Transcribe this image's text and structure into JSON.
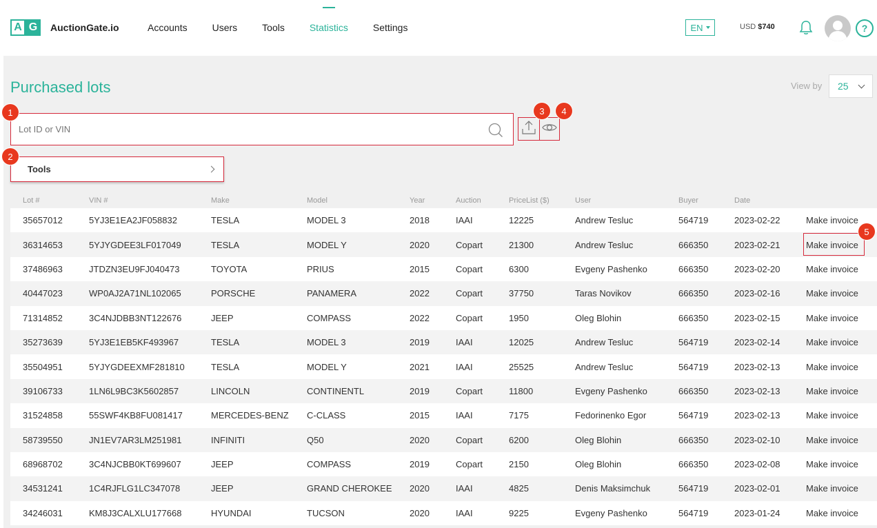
{
  "brand": {
    "logo_letter_a": "A",
    "logo_letter_g": "G",
    "name": "AuctionGate.io",
    "accent": "#2bb39a"
  },
  "nav": [
    {
      "label": "Accounts",
      "active": false
    },
    {
      "label": "Users",
      "active": false
    },
    {
      "label": "Tools",
      "active": false
    },
    {
      "label": "Statistics",
      "active": true
    },
    {
      "label": "Settings",
      "active": false
    }
  ],
  "header": {
    "language": "EN",
    "balance_currency": "USD",
    "balance_amount": "$740",
    "help": "?"
  },
  "page": {
    "title": "Purchased lots",
    "view_by_label": "View by",
    "view_by_value": "25",
    "search_placeholder": "Lot ID or VIN",
    "tools_label": "Tools"
  },
  "markers": [
    "1",
    "2",
    "3",
    "4",
    "5"
  ],
  "table": {
    "columns": [
      "Lot #",
      "VIN #",
      "Make",
      "Model",
      "Year",
      "Auction",
      "PriceList ($)",
      "User",
      "Buyer",
      "Date",
      ""
    ],
    "action_label": "Make invoice",
    "rows": [
      [
        "35657012",
        "5YJ3E1EA2JF058832",
        "TESLA",
        "MODEL 3",
        "2018",
        "IAAI",
        "12225",
        "Andrew Tesluc",
        "564719",
        "2023-02-22"
      ],
      [
        "36314653",
        "5YJYGDEE3LF017049",
        "TESLA",
        "MODEL Y",
        "2020",
        "Copart",
        "21300",
        "Andrew Tesluc",
        "666350",
        "2023-02-21"
      ],
      [
        "37486963",
        "JTDZN3EU9FJ040473",
        "TOYOTA",
        "PRIUS",
        "2015",
        "Copart",
        "6300",
        "Evgeny Pashenko",
        "666350",
        "2023-02-20"
      ],
      [
        "40447023",
        "WP0AJ2A71NL102065",
        "PORSCHE",
        "PANAMERA",
        "2022",
        "Copart",
        "37750",
        "Taras Novikov",
        "666350",
        "2023-02-16"
      ],
      [
        "71314852",
        "3C4NJDBB3NT122676",
        "JEEP",
        "COMPASS",
        "2022",
        "Copart",
        "1950",
        "Oleg Blohin",
        "666350",
        "2023-02-15"
      ],
      [
        "35273639",
        "5YJ3E1EB5KF493967",
        "TESLA",
        "MODEL 3",
        "2019",
        "IAAI",
        "12025",
        "Andrew Tesluc",
        "564719",
        "2023-02-14"
      ],
      [
        "35504951",
        "5YJYGDEEXMF281810",
        "TESLA",
        "MODEL Y",
        "2021",
        "IAAI",
        "25525",
        "Andrew Tesluc",
        "564719",
        "2023-02-13"
      ],
      [
        "39106733",
        "1LN6L9BC3K5602857",
        "LINCOLN",
        "CONTINENTL",
        "2019",
        "Copart",
        "11800",
        "Evgeny Pashenko",
        "666350",
        "2023-02-13"
      ],
      [
        "31524858",
        "55SWF4KB8FU081417",
        "MERCEDES-BENZ",
        "C-CLASS",
        "2015",
        "IAAI",
        "7175",
        "Fedorinenko Egor",
        "564719",
        "2023-02-13"
      ],
      [
        "58739550",
        "JN1EV7AR3LM251981",
        "INFINITI",
        "Q50",
        "2020",
        "Copart",
        "6200",
        "Oleg Blohin",
        "666350",
        "2023-02-10"
      ],
      [
        "68968702",
        "3C4NJCBB0KT699607",
        "JEEP",
        "COMPASS",
        "2019",
        "Copart",
        "2150",
        "Oleg Blohin",
        "666350",
        "2023-02-08"
      ],
      [
        "34531241",
        "1C4RJFLG1LC347078",
        "JEEP",
        "GRAND CHEROKEE",
        "2020",
        "IAAI",
        "4825",
        "Denis Maksimchuk",
        "564719",
        "2023-02-01"
      ],
      [
        "34246031",
        "KM8J3CALXLU177668",
        "HYUNDAI",
        "TUCSON",
        "2020",
        "IAAI",
        "9225",
        "Evgeny Pashenko",
        "564719",
        "2023-01-24"
      ]
    ]
  }
}
